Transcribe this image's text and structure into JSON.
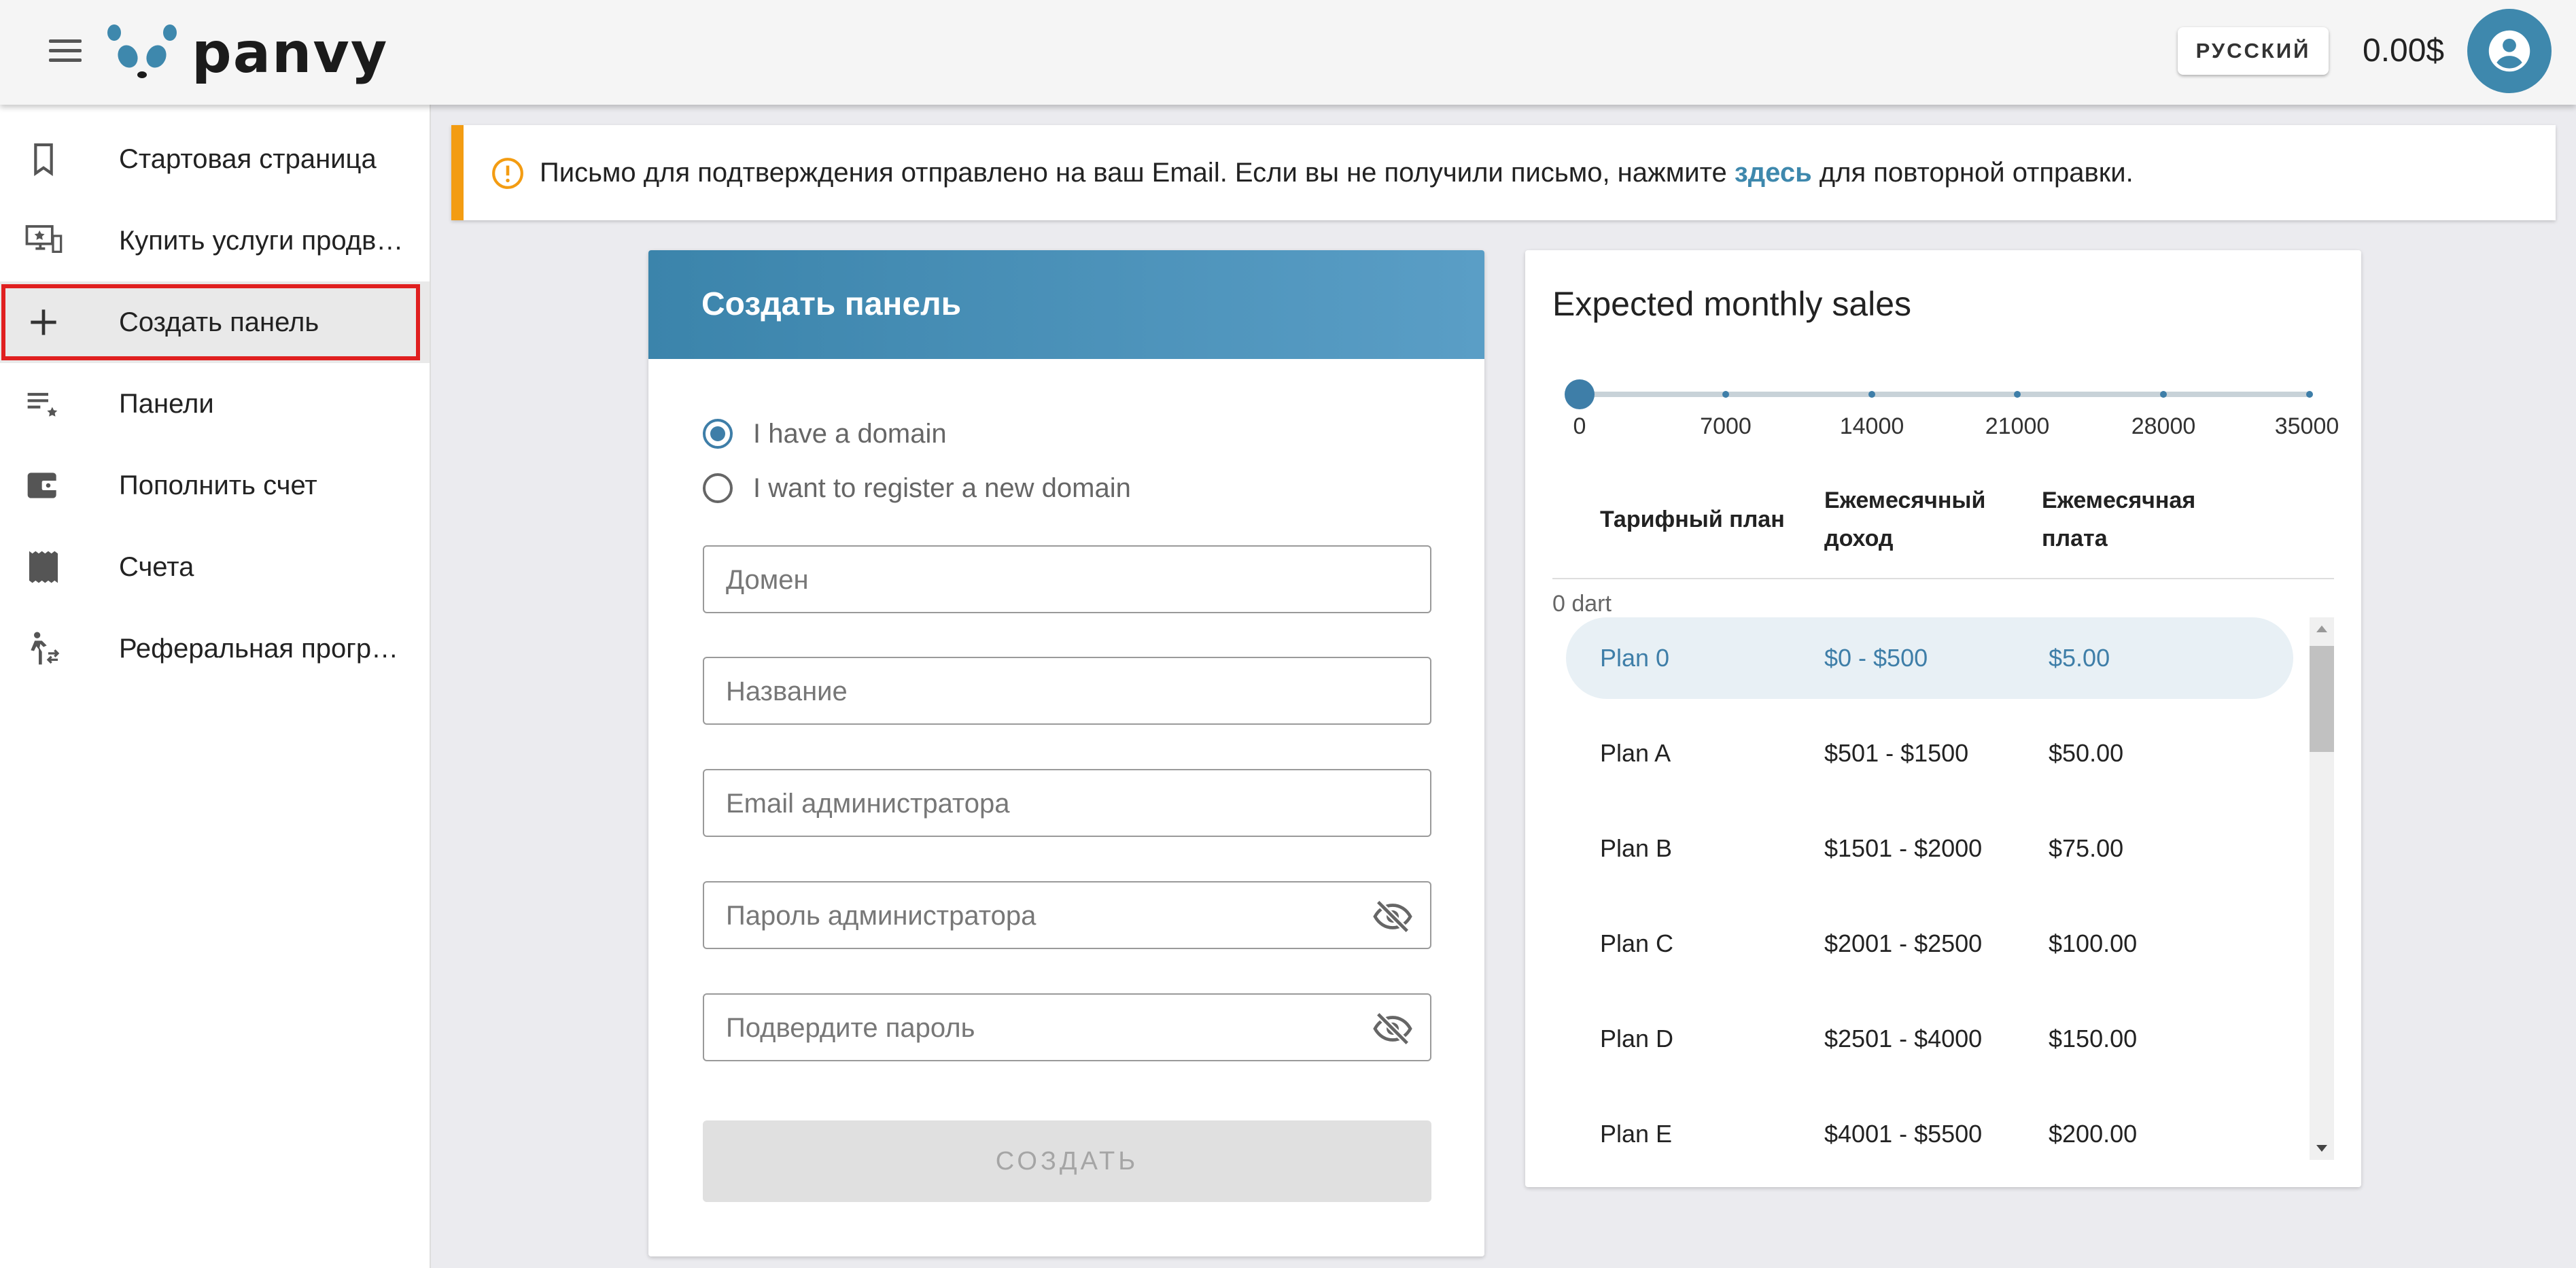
{
  "header": {
    "logo_text": "panvy",
    "language_button": "РУССКИЙ",
    "balance": "0.00$",
    "brand_color": "#3e88ad"
  },
  "sidebar": {
    "items": [
      {
        "label": "Стартовая страница",
        "icon": "bookmark-icon"
      },
      {
        "label": "Купить услуги продв…",
        "icon": "monitor-star-icon"
      },
      {
        "label": "Создать панель",
        "icon": "plus-icon",
        "active": true
      },
      {
        "label": "Панели",
        "icon": "list-star-icon"
      },
      {
        "label": "Пополнить счет",
        "icon": "wallet-icon"
      },
      {
        "label": "Счета",
        "icon": "receipt-icon"
      },
      {
        "label": "Реферальная програ…",
        "icon": "referral-icon"
      }
    ]
  },
  "notice": {
    "text_before": "Письмо для подтверждения отправлено на ваш Email. Если вы не получили письмо, нажмите ",
    "link": "здесь",
    "text_after": " для повторной отправки.",
    "accent_color": "#f39c12"
  },
  "create_form": {
    "title": "Создать панель",
    "radio_have_domain": "I have a domain",
    "radio_register": "I want to register a new domain",
    "selected_option": "I have a domain",
    "placeholder_domain": "Домен",
    "placeholder_name": "Название",
    "placeholder_email": "Email администратора",
    "placeholder_password": "Пароль администратора",
    "placeholder_confirm": "Подвердите пароль",
    "submit_label": "СОЗДАТЬ"
  },
  "sales": {
    "title": "Expected monthly sales",
    "slider": {
      "value": 0,
      "min": 0,
      "max": 35000,
      "labels": [
        "0",
        "7000",
        "14000",
        "21000",
        "28000",
        "35000"
      ]
    },
    "columns": {
      "plan": "Тарифный план",
      "income_line1": "Ежемесячный",
      "income_line2": "доход",
      "fee_line1": "Ежемесячная",
      "fee_line2": "плата"
    },
    "group_label": "0 dart",
    "plans": [
      {
        "plan": "Plan 0",
        "income": "$0 - $500",
        "fee": "$5.00",
        "selected": true
      },
      {
        "plan": "Plan A",
        "income": "$501 - $1500",
        "fee": "$50.00"
      },
      {
        "plan": "Plan B",
        "income": "$1501 - $2000",
        "fee": "$75.00"
      },
      {
        "plan": "Plan C",
        "income": "$2001 - $2500",
        "fee": "$100.00"
      },
      {
        "plan": "Plan D",
        "income": "$2501 - $4000",
        "fee": "$150.00"
      },
      {
        "plan": "Plan E",
        "income": "$4001 - $5500",
        "fee": "$200.00"
      }
    ]
  }
}
